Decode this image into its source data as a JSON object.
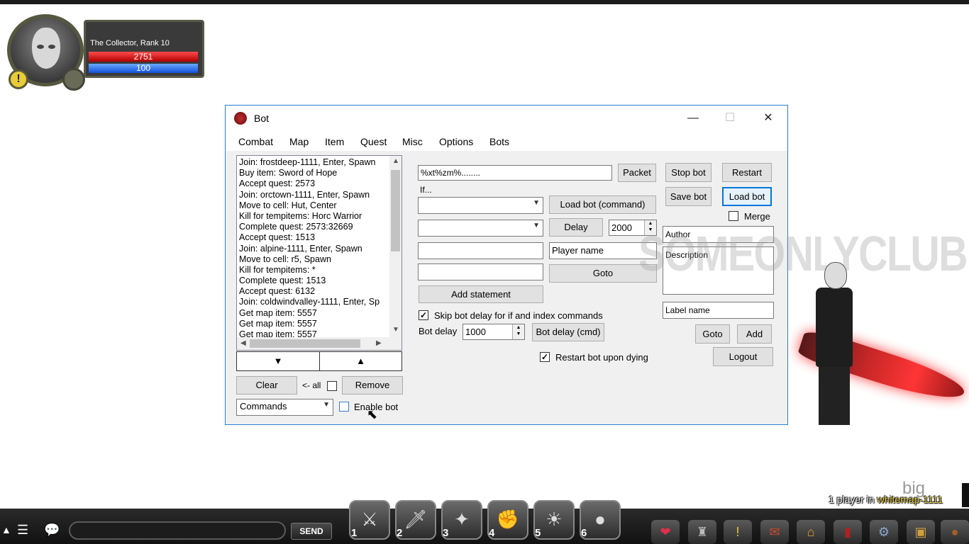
{
  "player": {
    "name_rank": "The Collector, Rank 10",
    "hp": "2751",
    "mp": "100"
  },
  "window": {
    "title": "Bot",
    "controls": {
      "minimize": "—",
      "maximize": "☐",
      "close": "✕"
    }
  },
  "menu": [
    "Combat",
    "Map",
    "Item",
    "Quest",
    "Misc",
    "Options",
    "Bots"
  ],
  "commands": [
    "Join: frostdeep-1111, Enter, Spawn",
    "Buy item: Sword of Hope",
    "Accept quest: 2573",
    "Join: orctown-1111, Enter, Spawn",
    "Move to cell: Hut, Center",
    "Kill for tempitems: Horc Warrior",
    "Complete quest: 2573:32669",
    "Accept quest: 1513",
    "Join: alpine-1111, Enter, Spawn",
    "Move to cell: r5, Spawn",
    "Kill for tempitems: *",
    "Complete quest: 1513",
    "Accept quest: 6132",
    "Join: coldwindvalley-1111, Enter, Sp",
    "Get map item: 5557",
    "Get map item: 5557",
    "Get map item: 5557"
  ],
  "list_controls": {
    "move_down": "▼",
    "move_up": "▲",
    "clear": "Clear",
    "all_label": "<- all",
    "remove": "Remove",
    "mode_select": "Commands",
    "enable_bot": "Enable bot"
  },
  "center": {
    "packet_value": "%xt%zm%........",
    "packet_btn": "Packet",
    "if_label": "If...",
    "load_bot_cmd": "Load bot (command)",
    "delay_btn": "Delay",
    "delay_value": "2000",
    "player_name_placeholder": "Player name",
    "goto_btn": "Goto",
    "add_statement": "Add statement",
    "skip_delay_label": "Skip bot delay for if and index commands",
    "bot_delay_label": "Bot delay",
    "bot_delay_value": "1000",
    "bot_delay_cmd": "Bot delay (cmd)",
    "restart_dying_label": "Restart bot upon dying"
  },
  "right": {
    "stop_bot": "Stop bot",
    "restart": "Restart",
    "save_bot": "Save bot",
    "load_bot": "Load bot",
    "merge": "Merge",
    "author_placeholder": "Author",
    "description_placeholder": "Description",
    "label_name_placeholder": "Label name",
    "goto": "Goto",
    "add": "Add",
    "logout": "Logout"
  },
  "watermark": "SOMEONLYCLUB",
  "bottom": {
    "send": "SEND",
    "skills": [
      "1",
      "2",
      "3",
      "4",
      "5",
      "6"
    ],
    "big_text": "big",
    "players_prefix": "1 player in ",
    "map_name": "whitemap-1111"
  }
}
